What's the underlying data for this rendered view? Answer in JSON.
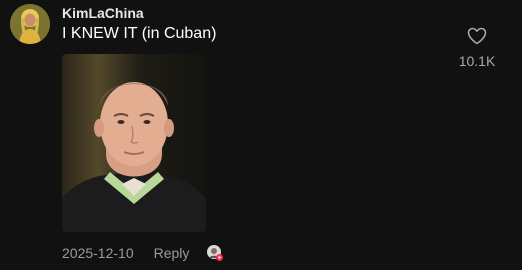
{
  "comment": {
    "username": "KimLaChina",
    "text": "I KNEW IT (in Cuban)",
    "date": "2025-12-10",
    "reply_label": "Reply",
    "like_count": "10.1K",
    "icons": {
      "like": "heart-outline-icon",
      "reaction": "creator-reaction-avatar-icon"
    }
  },
  "colors": {
    "background": "#111111",
    "text_primary": "#ffffff",
    "text_secondary": "#9b9b9b",
    "reaction_badge": "#fe2c55"
  }
}
